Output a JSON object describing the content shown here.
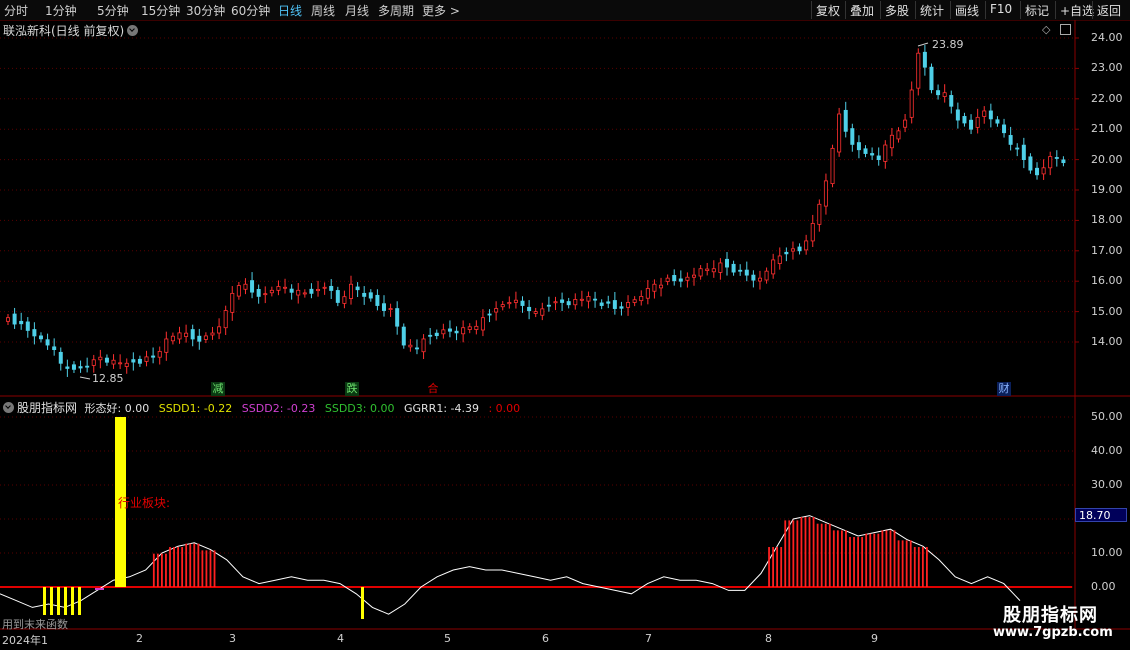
{
  "toolbar": {
    "left": [
      "分时",
      "1分钟",
      "5分钟",
      "15分钟",
      "30分钟",
      "60分钟",
      "日线",
      "周线",
      "月线",
      "多周期",
      "更多"
    ],
    "active": "日线",
    "right": [
      "复权",
      "叠加",
      "多股",
      "统计",
      "画线",
      "F10",
      "标记",
      "+自选",
      "返回"
    ]
  },
  "title": "联泓新科(日线 前复权)",
  "price_axis": [
    "24.00",
    "23.00",
    "22.00",
    "21.00",
    "20.00",
    "19.00",
    "18.00",
    "17.00",
    "16.00",
    "15.00",
    "14.00"
  ],
  "price_annotations": {
    "high": "23.89",
    "low": "12.85"
  },
  "event_markers": [
    {
      "label": "减",
      "color": "#1aa64a"
    },
    {
      "label": "跌",
      "color": "#1aa64a"
    },
    {
      "label": "合",
      "color": "#d00000"
    },
    {
      "label": "财",
      "color": "#2a6ad8"
    }
  ],
  "indicator": {
    "name": "股朋指标网",
    "items": [
      {
        "label": "形态好: 0.00",
        "color": "#e0e0e0"
      },
      {
        "label": "SSDD1: -0.22",
        "color": "#e0e000"
      },
      {
        "label": "SSDD2: -0.23",
        "color": "#d040d0"
      },
      {
        "label": "SSDD3: 0.00",
        "color": "#30c030"
      },
      {
        "label": "GGRR1: -4.39",
        "color": "#e0e0e0"
      },
      {
        "label": ": 0.00",
        "color": "#e00000"
      }
    ],
    "axis": [
      "50.00",
      "40.00",
      "30.00",
      "20.00",
      "10.00",
      "0.00"
    ],
    "current_value": "18.70",
    "industry_label": "行业板块:"
  },
  "dates": [
    "2024年1",
    "2",
    "3",
    "4",
    "5",
    "6",
    "7",
    "8",
    "9"
  ],
  "overlay_text": "用到末来函数",
  "watermark": {
    "title": "股朋指标网",
    "url": "www.7gpzb.com"
  },
  "colors": {
    "up": "#ff3030",
    "down": "#4fd0e8",
    "line": "#ffffff",
    "yellow": "#ffff00",
    "grid": "#5a0000"
  },
  "chart_data": {
    "type": "candlestick",
    "close_series": [
      14.8,
      14.6,
      14.2,
      13.9,
      13.3,
      13.1,
      13.2,
      13.5,
      13.4,
      13.3,
      13.3,
      13.5,
      14.1,
      14.3,
      14.1,
      14.2,
      14.5,
      15.6,
      15.9,
      15.5,
      15.7,
      15.8,
      15.7,
      15.6,
      15.8,
      15.3,
      15.9,
      15.5,
      15.2,
      15.1,
      13.9,
      13.8,
      14.2,
      14.4,
      14.3,
      14.5,
      14.8,
      15.1,
      15.3,
      15.2,
      15.0,
      15.2,
      15.3,
      15.4,
      15.5,
      15.2,
      15.1,
      15.3,
      15.5,
      15.9,
      16.1,
      16.0,
      16.2,
      16.4,
      16.6,
      16.3,
      16.2,
      16.1,
      16.7,
      16.9,
      17.0,
      17.9,
      19.3,
      21.5,
      20.5,
      20.2,
      20.0,
      20.8,
      21.3,
      23.5,
      22.3,
      22.2,
      21.3,
      21.0,
      21.6,
      21.2,
      20.5,
      20.0,
      19.5,
      20.1,
      19.9
    ],
    "indicator_series": {
      "white_line": [
        -2,
        -4,
        -6,
        -5,
        -6,
        -4,
        -1,
        2,
        3,
        5,
        10,
        12,
        13,
        11,
        8,
        3,
        1,
        2,
        3,
        2,
        2,
        1,
        -2,
        -6,
        -8,
        -5,
        0,
        3,
        5,
        6,
        5,
        5,
        4,
        3,
        2,
        3,
        1,
        0,
        -1,
        -2,
        1,
        3,
        2,
        2,
        1,
        -1,
        -1,
        4,
        12,
        20,
        21,
        19,
        17,
        15,
        16,
        17,
        14,
        12,
        8,
        3,
        1,
        3,
        1,
        -4
      ],
      "yellow_bars": [
        -8,
        -8,
        -8,
        -8,
        -7,
        50,
        -7
      ],
      "red_peak": 21.0
    }
  }
}
